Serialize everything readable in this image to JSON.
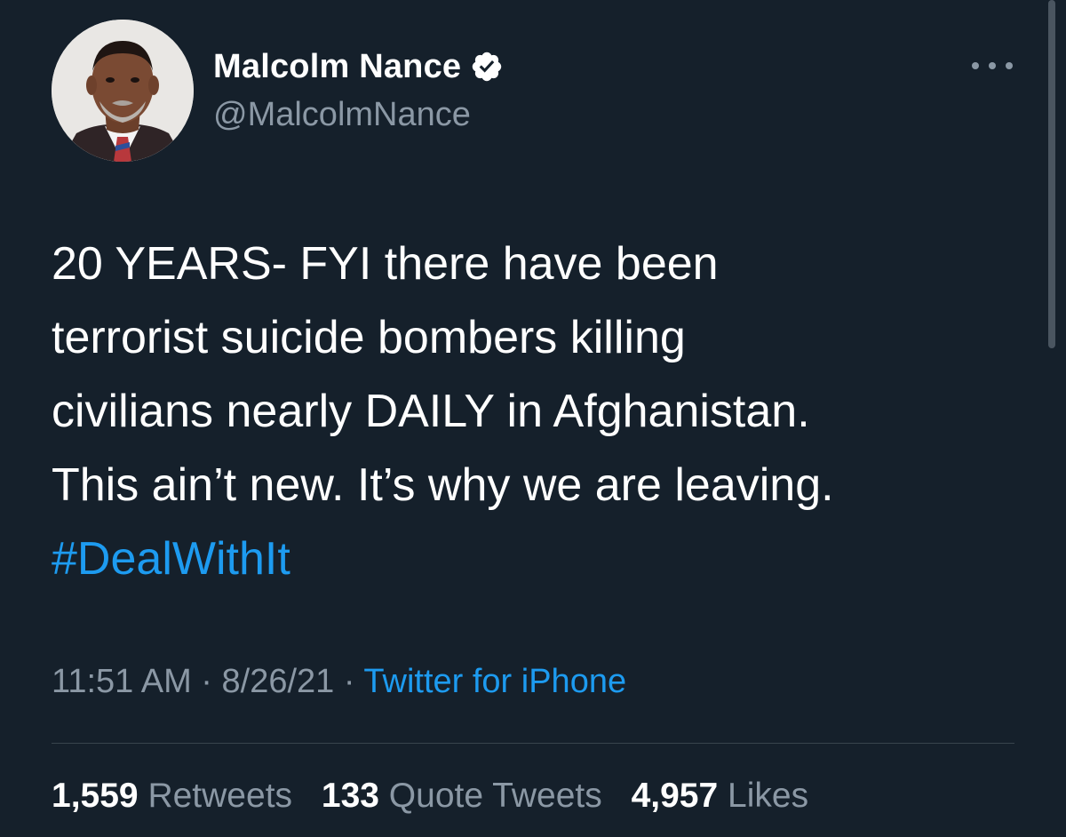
{
  "author": {
    "display_name": "Malcolm Nance",
    "handle": "@MalcolmNance",
    "verified_icon": "verified-badge-icon",
    "avatar": "profile-photo"
  },
  "menu": {
    "icon": "more-options-icon"
  },
  "tweet": {
    "lines": [
      "20 YEARS- FYI there have been",
      "terrorist suicide bombers killing",
      "civilians nearly DAILY in Afghanistan.",
      "This ain’t new. It’s why we are leaving."
    ],
    "hashtag": "#DealWithIt"
  },
  "meta": {
    "time": "11:51 AM",
    "separator": " · ",
    "date": "8/26/21",
    "source": "Twitter for iPhone"
  },
  "stats": {
    "retweets_count": "1,559",
    "retweets_label": "Retweets",
    "quotes_count": "133",
    "quotes_label": "Quote Tweets",
    "likes_count": "4,957",
    "likes_label": "Likes"
  },
  "colors": {
    "background": "#15202b",
    "primary_text": "#ffffff",
    "secondary_text": "#8b98a5",
    "link": "#1d9bf0",
    "divider": "#38444d"
  }
}
